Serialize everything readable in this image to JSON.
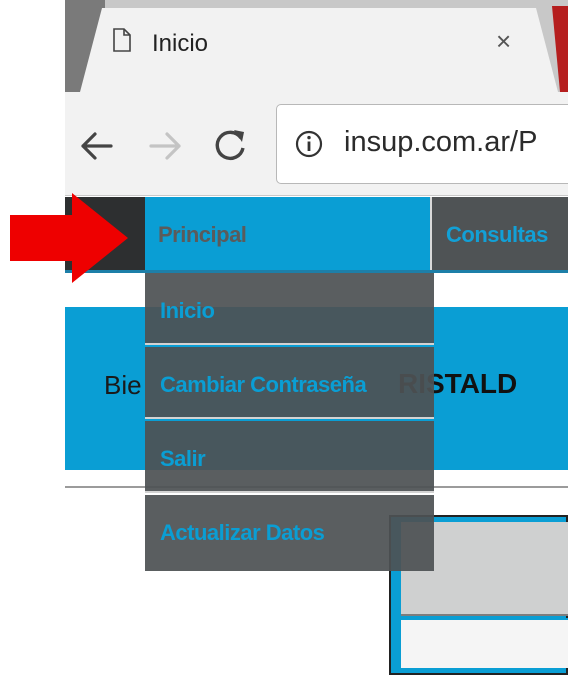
{
  "browser": {
    "tab": {
      "title": "Inicio",
      "close_label": "×"
    },
    "address": {
      "url": "insup.com.ar/P"
    }
  },
  "nav": {
    "items": [
      {
        "label": "Principal"
      },
      {
        "label": "Consultas"
      }
    ]
  },
  "dropdown": {
    "items": [
      {
        "label": "Inicio"
      },
      {
        "label": "Cambiar Contraseña"
      },
      {
        "label": "Salir"
      },
      {
        "label": "Actualizar Datos"
      }
    ]
  },
  "banner": {
    "welcome_prefix": "Bie",
    "name_visible": "RISTALD"
  },
  "colors": {
    "accent_blue": "#0a9ed4",
    "nav_dark": "#4f5355",
    "annotation_arrow": "#ee0000"
  },
  "icons": [
    "page-icon",
    "back-arrow-icon",
    "forward-arrow-icon",
    "reload-icon",
    "info-icon",
    "close-icon"
  ]
}
